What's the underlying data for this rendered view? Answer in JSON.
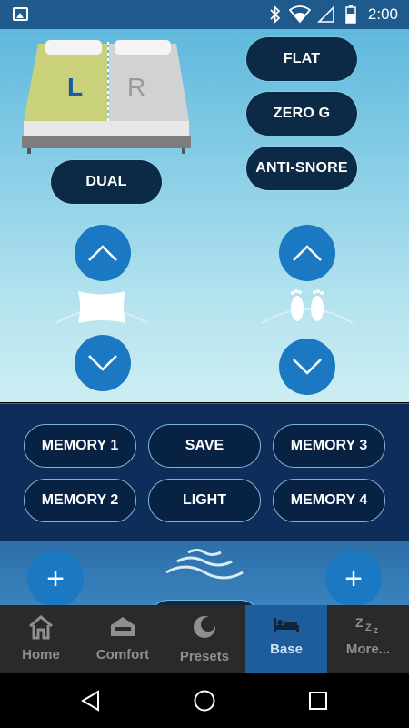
{
  "status_bar": {
    "time": "2:00"
  },
  "bed": {
    "left_label": "L",
    "right_label": "R"
  },
  "presets": {
    "flat": "FLAT",
    "zero_g": "ZERO G",
    "anti_snore": "ANTI-SNORE",
    "dual": "DUAL"
  },
  "memory": {
    "memory1": "MEMORY 1",
    "save": "SAVE",
    "memory3": "MEMORY 3",
    "memory2": "MEMORY 2",
    "light": "LIGHT",
    "memory4": "MEMORY 4"
  },
  "massage": {
    "plus_left": "+",
    "plus_right": "+"
  },
  "bottom_nav": {
    "items": [
      {
        "label": "Home",
        "icon": "home-icon"
      },
      {
        "label": "Comfort",
        "icon": "bed-comfort-icon"
      },
      {
        "label": "Presets",
        "icon": "moon-icon"
      },
      {
        "label": "Base",
        "icon": "bed-icon"
      },
      {
        "label": "More...",
        "icon": "zzz-icon"
      }
    ],
    "active": "Base"
  },
  "colors": {
    "accent": "#1a79c2",
    "pill": "#0c2a45",
    "nav_active": "#1e5d9c"
  }
}
